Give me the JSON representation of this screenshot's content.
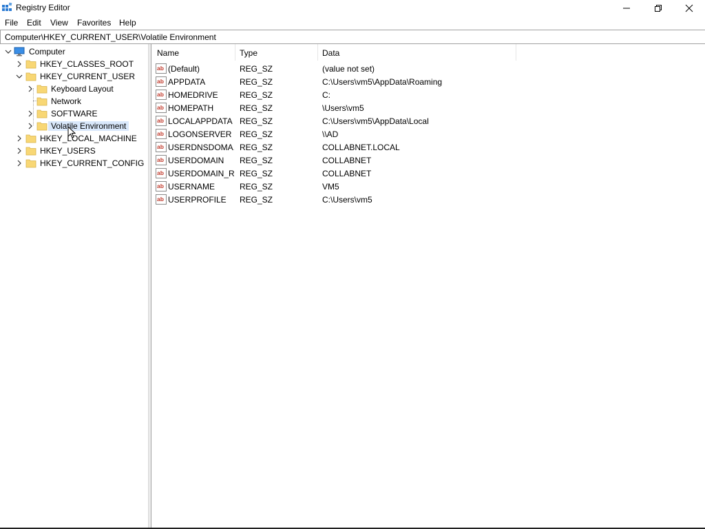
{
  "window": {
    "title": "Registry Editor",
    "icon": "registry-editor-icon"
  },
  "menu": [
    "File",
    "Edit",
    "View",
    "Favorites",
    "Help"
  ],
  "address": "Computer\\HKEY_CURRENT_USER\\Volatile Environment",
  "tree": {
    "computer": "Computer",
    "hkcr": "HKEY_CLASSES_ROOT",
    "hkcu": "HKEY_CURRENT_USER",
    "hkcu_children": [
      "Keyboard Layout",
      "Network",
      "SOFTWARE",
      "Volatile Environment"
    ],
    "hklm": "HKEY_LOCAL_MACHINE",
    "hku": "HKEY_USERS",
    "hkcc": "HKEY_CURRENT_CONFIG",
    "selected": "Volatile Environment"
  },
  "list": {
    "columns": [
      "Name",
      "Type",
      "Data"
    ],
    "rows": [
      {
        "name": "(Default)",
        "type": "REG_SZ",
        "data": "(value not set)"
      },
      {
        "name": "APPDATA",
        "type": "REG_SZ",
        "data": "C:\\Users\\vm5\\AppData\\Roaming"
      },
      {
        "name": "HOMEDRIVE",
        "type": "REG_SZ",
        "data": "C:"
      },
      {
        "name": "HOMEPATH",
        "type": "REG_SZ",
        "data": "\\Users\\vm5"
      },
      {
        "name": "LOCALAPPDATA",
        "type": "REG_SZ",
        "data": "C:\\Users\\vm5\\AppData\\Local"
      },
      {
        "name": "LOGONSERVER",
        "type": "REG_SZ",
        "data": "\\\\AD"
      },
      {
        "name": "USERDNSDOMA...",
        "type": "REG_SZ",
        "data": "COLLABNET.LOCAL"
      },
      {
        "name": "USERDOMAIN",
        "type": "REG_SZ",
        "data": "COLLABNET"
      },
      {
        "name": "USERDOMAIN_R...",
        "type": "REG_SZ",
        "data": "COLLABNET"
      },
      {
        "name": "USERNAME",
        "type": "REG_SZ",
        "data": "VM5"
      },
      {
        "name": "USERPROFILE",
        "type": "REG_SZ",
        "data": "C:\\Users\\vm5"
      }
    ]
  },
  "colors": {
    "folder": "#f8d775",
    "selection": "#d9e8fb",
    "ab_red": "#c0392b"
  }
}
